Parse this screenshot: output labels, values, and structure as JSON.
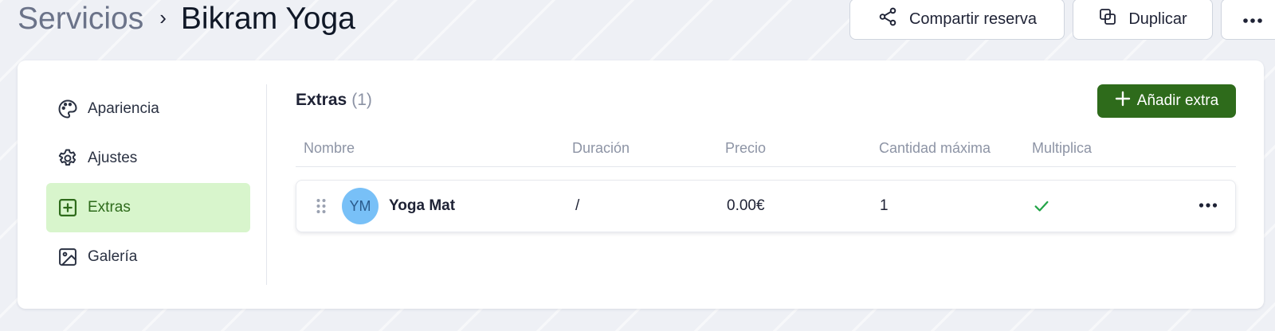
{
  "breadcrumb": {
    "root": "Servicios",
    "separator": "›",
    "current": "Bikram Yoga"
  },
  "header_actions": {
    "share_label": "Compartir reserva",
    "duplicate_label": "Duplicar",
    "more_icon": "more-horizontal-icon"
  },
  "sidebar": {
    "items": [
      {
        "label": "Apariencia",
        "icon": "palette-icon",
        "active": false
      },
      {
        "label": "Ajustes",
        "icon": "gear-icon",
        "active": false
      },
      {
        "label": "Extras",
        "icon": "plus-square-icon",
        "active": true
      },
      {
        "label": "Galería",
        "icon": "image-icon",
        "active": false
      }
    ]
  },
  "extras": {
    "title": "Extras",
    "count": "(1)",
    "add_label": "Añadir extra",
    "columns": [
      "Nombre",
      "Duración",
      "Precio",
      "Cantidad máxima",
      "Multiplica"
    ],
    "rows": [
      {
        "initials": "YM",
        "name": "Yoga Mat",
        "duration": "/",
        "price": "0.00€",
        "max_quantity": "1",
        "multiplies": true
      }
    ]
  },
  "colors": {
    "accent": "#2e6b1b",
    "active_bg": "#d8f5cc",
    "avatar_bg": "#78c0f7",
    "check": "#22a447"
  }
}
